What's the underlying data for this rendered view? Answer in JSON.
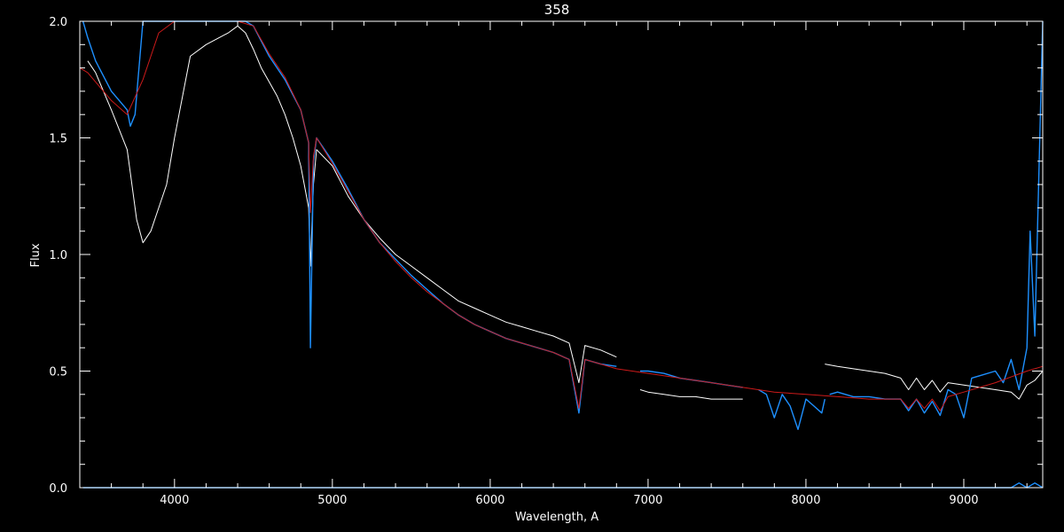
{
  "chart_data": {
    "type": "line",
    "title": "358",
    "xlabel": "Wavelength, A",
    "ylabel": "Flux",
    "xlim": [
      3400,
      9500
    ],
    "ylim": [
      0.0,
      2.0
    ],
    "x_ticks": [
      4000,
      5000,
      6000,
      7000,
      8000,
      9000
    ],
    "x_tick_labels": [
      "4000",
      "5000",
      "6000",
      "7000",
      "8000",
      "9000"
    ],
    "y_ticks": [
      0.0,
      0.5,
      1.0,
      1.5,
      2.0
    ],
    "y_tick_labels": [
      "0.0",
      "0.5",
      "1.0",
      "1.5",
      "2.0"
    ],
    "grid": false,
    "background": "#000000",
    "series": [
      {
        "color": "#ffffff",
        "segments": [
          {
            "x": [
              3450,
              3500,
              3600,
              3700,
              3720,
              3760,
              3800,
              3850,
              3900,
              3950,
              4000,
              4100,
              4200,
              4340,
              4400,
              4450,
              4500,
              4550,
              4600,
              4650,
              4700,
              4750,
              4800,
              4850,
              4861,
              4880,
              4900,
              5000,
              5100,
              5200,
              5300,
              5400,
              5500,
              5600,
              5700,
              5800,
              5900,
              6000,
              6100,
              6200,
              6300,
              6400,
              6500,
              6562,
              6600,
              6700,
              6800
            ],
            "y": [
              1.83,
              1.78,
              1.62,
              1.45,
              1.35,
              1.15,
              1.05,
              1.1,
              1.2,
              1.3,
              1.5,
              1.85,
              1.9,
              1.95,
              1.98,
              1.95,
              1.88,
              1.8,
              1.74,
              1.68,
              1.6,
              1.5,
              1.38,
              1.2,
              0.95,
              1.3,
              1.45,
              1.38,
              1.25,
              1.15,
              1.07,
              1.0,
              0.95,
              0.9,
              0.85,
              0.8,
              0.77,
              0.74,
              0.71,
              0.69,
              0.67,
              0.65,
              0.62,
              0.45,
              0.61,
              0.59,
              0.56
            ]
          },
          {
            "x": [
              6950,
              7000,
              7100,
              7200,
              7300,
              7400,
              7500,
              7600
            ],
            "y": [
              0.42,
              0.41,
              0.4,
              0.39,
              0.39,
              0.38,
              0.38,
              0.38
            ]
          },
          {
            "x": [
              8120,
              8200,
              8300,
              8400,
              8500,
              8600,
              8650,
              8700,
              8750,
              8800,
              8850,
              8900,
              9000,
              9100,
              9200,
              9300,
              9350,
              9400,
              9450,
              9500
            ],
            "y": [
              0.53,
              0.52,
              0.51,
              0.5,
              0.49,
              0.47,
              0.42,
              0.47,
              0.42,
              0.46,
              0.41,
              0.45,
              0.44,
              0.43,
              0.42,
              0.41,
              0.38,
              0.44,
              0.46,
              0.5
            ]
          }
        ]
      },
      {
        "color": "#1e90ff",
        "segments": [
          {
            "x": [
              3420,
              3450,
              3500,
              3600,
              3700,
              3720,
              3750,
              3800,
              3850,
              3900,
              3970,
              4000,
              4101,
              4200,
              4340,
              4400,
              4450,
              4500,
              4600,
              4700,
              4800,
              4850,
              4861,
              4880,
              4900,
              5000,
              5100,
              5200,
              5300,
              5400,
              5500,
              5600,
              5700,
              5800,
              5900,
              6000,
              6100,
              6200,
              6300,
              6400,
              6500,
              6562,
              6600,
              6700,
              6800
            ],
            "y": [
              2.0,
              1.93,
              1.83,
              1.7,
              1.62,
              1.55,
              1.6,
              2.0,
              2.0,
              2.0,
              2.0,
              2.0,
              2.0,
              2.0,
              2.0,
              2.0,
              2.0,
              1.98,
              1.85,
              1.75,
              1.62,
              1.48,
              0.6,
              1.4,
              1.5,
              1.4,
              1.28,
              1.15,
              1.05,
              0.98,
              0.91,
              0.85,
              0.79,
              0.74,
              0.7,
              0.67,
              0.64,
              0.62,
              0.6,
              0.58,
              0.55,
              0.32,
              0.55,
              0.53,
              0.52
            ]
          },
          {
            "x": [
              6950,
              7000,
              7100,
              7200,
              7300,
              7400,
              7500,
              7600
            ],
            "y": [
              0.5,
              0.5,
              0.49,
              0.47,
              0.46,
              0.45,
              0.44,
              0.43
            ]
          },
          {
            "x": [
              7700,
              7750,
              7800,
              7850,
              7900,
              7950,
              8000,
              8050,
              8100,
              8120
            ],
            "y": [
              0.42,
              0.4,
              0.3,
              0.4,
              0.35,
              0.25,
              0.38,
              0.35,
              0.32,
              0.38
            ]
          },
          {
            "x": [
              8150,
              8200,
              8300,
              8400,
              8500,
              8600,
              8650,
              8700,
              8750,
              8800,
              8850,
              8900,
              8950,
              9000,
              9050,
              9100,
              9200,
              9250,
              9300,
              9350,
              9400,
              9420,
              9450,
              9500
            ],
            "y": [
              0.4,
              0.41,
              0.39,
              0.39,
              0.38,
              0.38,
              0.33,
              0.38,
              0.32,
              0.37,
              0.31,
              0.42,
              0.4,
              0.3,
              0.47,
              0.48,
              0.5,
              0.45,
              0.55,
              0.42,
              0.6,
              1.1,
              0.65,
              2.0
            ]
          },
          {
            "x": [
              3420,
              4000,
              5000,
              6000,
              7000,
              8000,
              9000,
              9300,
              9350,
              9400,
              9450,
              9500
            ],
            "y": [
              0.0,
              0.0,
              0.0,
              0.0,
              0.0,
              0.0,
              0.0,
              0.0,
              0.02,
              0.0,
              0.02,
              0.0
            ]
          }
        ]
      },
      {
        "color": "#cc1a1a",
        "segments": [
          {
            "x": [
              3400,
              3450,
              3500,
              3600,
              3700,
              3800,
              3900,
              4000,
              4100,
              4200,
              4340,
              4400,
              4500,
              4600,
              4700,
              4800,
              4850,
              4861,
              4880,
              4900,
              5000,
              5100,
              5200,
              5300,
              5400,
              5500,
              5600,
              5700,
              5800,
              5900,
              6000,
              6100,
              6200,
              6300,
              6400,
              6500,
              6562,
              6600,
              6700,
              6800,
              7000,
              7200,
              7400,
              7600,
              7800,
              8000,
              8200,
              8400,
              8600,
              8650,
              8700,
              8750,
              8800,
              8850,
              8900,
              9000,
              9200,
              9400,
              9500
            ],
            "y": [
              1.8,
              1.78,
              1.74,
              1.66,
              1.6,
              1.75,
              1.95,
              2.0,
              2.0,
              2.0,
              2.0,
              2.0,
              1.98,
              1.86,
              1.76,
              1.62,
              1.48,
              1.18,
              1.42,
              1.5,
              1.39,
              1.27,
              1.15,
              1.05,
              0.97,
              0.9,
              0.84,
              0.79,
              0.74,
              0.7,
              0.67,
              0.64,
              0.62,
              0.6,
              0.58,
              0.55,
              0.34,
              0.55,
              0.53,
              0.51,
              0.49,
              0.47,
              0.45,
              0.43,
              0.41,
              0.4,
              0.39,
              0.38,
              0.38,
              0.34,
              0.38,
              0.34,
              0.38,
              0.33,
              0.39,
              0.41,
              0.45,
              0.5,
              0.52
            ]
          }
        ]
      }
    ]
  }
}
